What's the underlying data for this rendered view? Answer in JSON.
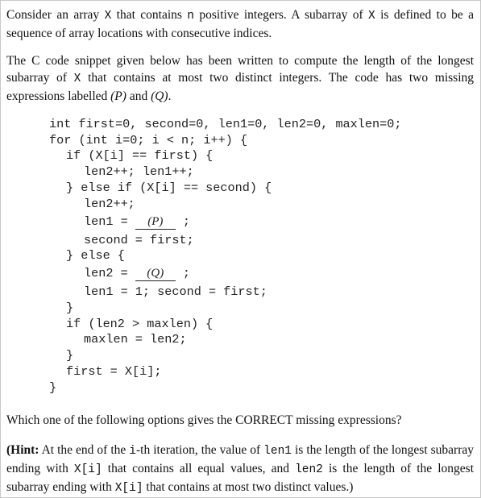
{
  "para1": {
    "part1": "Consider an array ",
    "var_x": "X",
    "part2": " that contains ",
    "var_n": "n",
    "part3": " positive integers. A subarray of ",
    "var_x2": "X",
    "part4": " is defined to be a sequence of array locations with consecutive indices."
  },
  "para2": {
    "part1": "The C code snippet given below has been written to compute the length of the longest subarray of ",
    "var_x": "X",
    "part2": " that contains at most two distinct integers. The code has two missing expressions labelled ",
    "label_p": "(P)",
    "part3": " and ",
    "label_q": "(Q)",
    "part4": "."
  },
  "code": {
    "line1": "int first=0, second=0, len1=0, len2=0, maxlen=0;",
    "line2": "for (int i=0; i < n; i++) {",
    "line3": "if (X[i] == first) {",
    "line4": "len2++; len1++;",
    "line5": "} else if (X[i] == second) {",
    "line6": "len2++;",
    "line7_pre": "len1 = ",
    "line7_blank": "(P)",
    "line7_post": " ;",
    "line8": "second = first;",
    "line9": "} else {",
    "line10_pre": "len2 = ",
    "line10_blank": "(Q)",
    "line10_post": " ;",
    "line11": "len1 = 1; second = first;",
    "line12": "}",
    "line13": "if (len2 > maxlen) {",
    "line14": "maxlen = len2;",
    "line15": "}",
    "line16": "first = X[i];",
    "line17": "}"
  },
  "question": "Which one of the following options gives the CORRECT missing expressions?",
  "hint": {
    "bold": "(Hint:",
    "part1": " At the end of the ",
    "code1": "i",
    "part2": "-th iteration, the value of ",
    "code2": "len1",
    "part3": " is the length of the longest subarray ending with ",
    "code3": "X[i]",
    "part4": " that contains all equal values, and ",
    "code4": "len2",
    "part5": " is the length of the longest subarray ending with ",
    "code5": "X[i]",
    "part6": " that contains at most two distinct values.)"
  }
}
